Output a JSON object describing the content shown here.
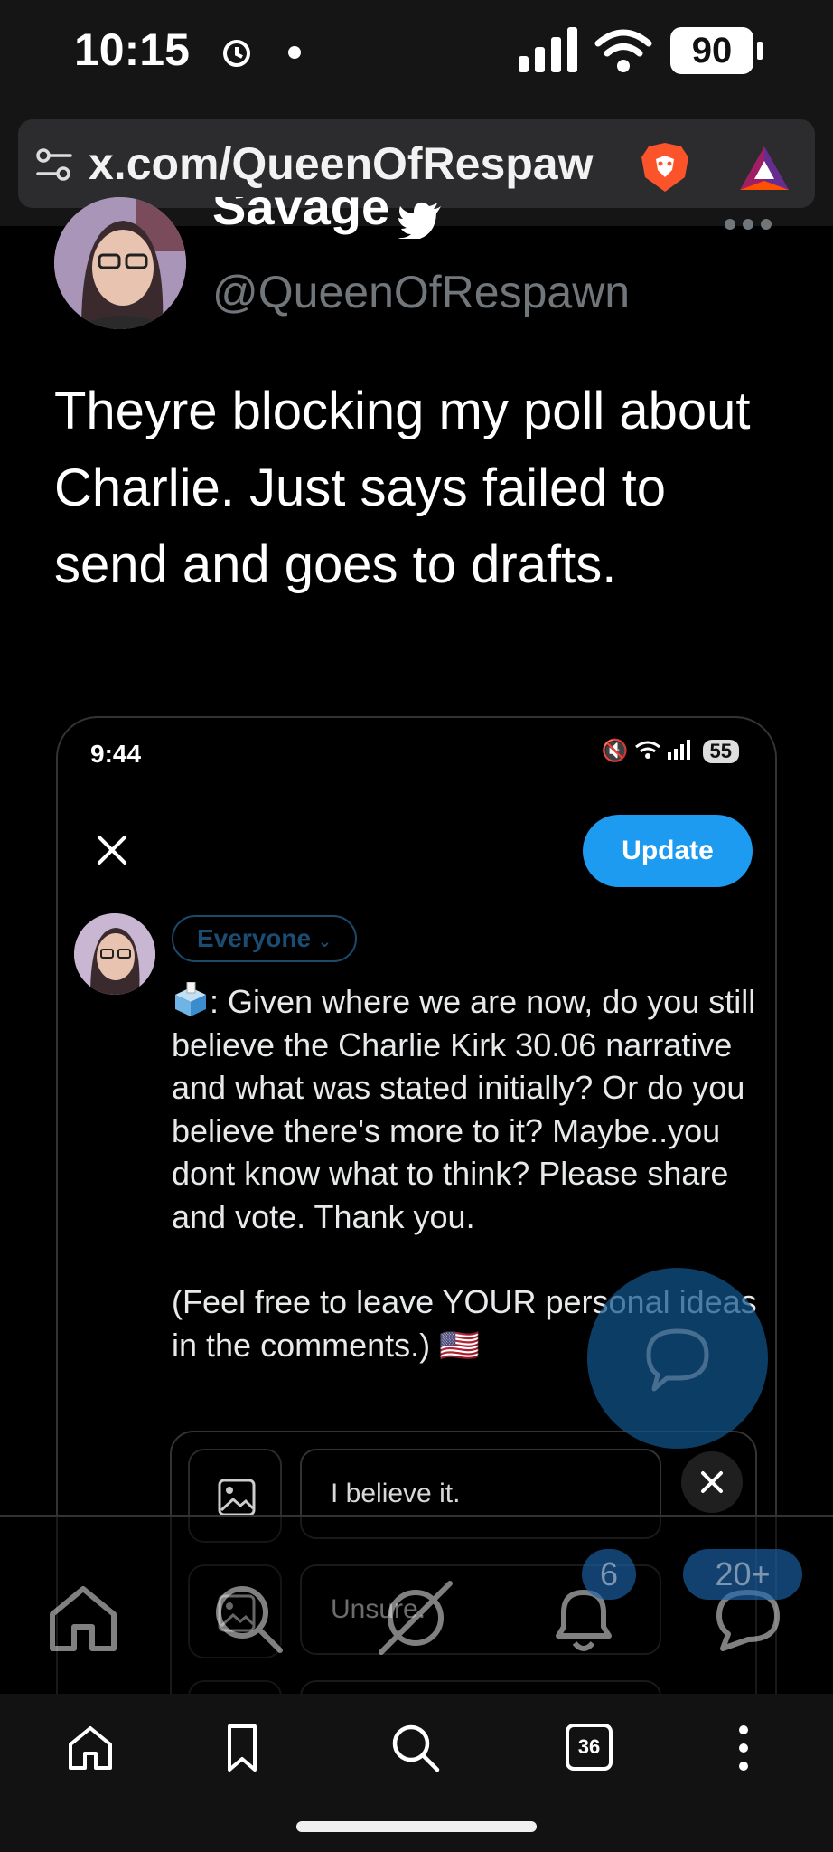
{
  "status_bar": {
    "time": "10:15",
    "battery": "90"
  },
  "browser": {
    "url": "x.com/QueenOfRespaw",
    "tab_count": "36"
  },
  "tweet": {
    "display_name": "Savage",
    "handle": "@QueenOfRespawn",
    "text": "Theyre blocking my poll about Charlie. Just says failed to send and goes to drafts."
  },
  "embedded_screenshot": {
    "time": "9:44",
    "battery": "55",
    "update_label": "Update",
    "audience_label": "Everyone",
    "post_text": ": Given where we are now, do you still believe the Charlie Kirk 30.06 narrative and what was stated initially? Or do you believe there's more to it? Maybe..you dont know what to think? Please share and vote. Thank you.",
    "post_text_2": "(Feel free to leave YOUR personal ideas in the comments.)",
    "post_flag": "🇺🇸",
    "poll_options": [
      "I believe it.",
      "Unsure."
    ]
  },
  "x_nav": {
    "notifications_badge": "6",
    "messages_badge": "20+"
  },
  "colors": {
    "accent": "#1d9bf0",
    "background": "#000000",
    "secondary_text": "#71767b"
  }
}
